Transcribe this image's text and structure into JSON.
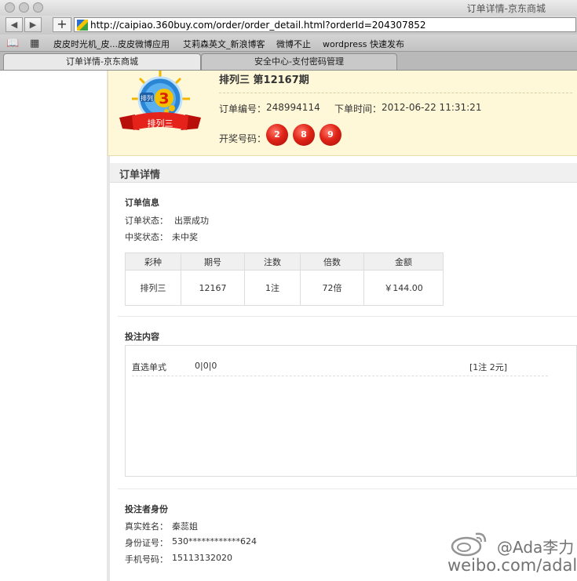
{
  "window": {
    "title": "订单详情-京东商城"
  },
  "toolbar": {
    "url": "http://caipiao.360buy.com/order/order_detail.html?orderId=204307852"
  },
  "bookmarks": [
    {
      "label": "皮皮时光机_皮...皮皮微博应用"
    },
    {
      "label": "艾莉森英文_新浪博客"
    },
    {
      "label": "微博不止"
    },
    {
      "label": "wordpress 快速发布"
    }
  ],
  "tabs": [
    {
      "label": "订单详情-京东商城"
    },
    {
      "label": "安全中心-支付密码管理"
    }
  ],
  "banner": {
    "logo_badge": "排列",
    "logo_number": "3",
    "logo_ribbon": "排列三",
    "lottery_title": "排列三 第12167期",
    "order_no_label": "订单编号：",
    "order_no": "248994114",
    "order_time_label": "下单时间：",
    "order_time": "2012-06-22 11:31:21",
    "draw_label": "开奖号码：",
    "draw_numbers": [
      "2",
      "8",
      "9"
    ]
  },
  "detail": {
    "heading": "订单详情",
    "info_title": "订单信息",
    "status_label": "订单状态：",
    "status_value": "出票成功",
    "win_label": "中奖状态：",
    "win_value": "未中奖",
    "table": {
      "headers": [
        "彩种",
        "期号",
        "注数",
        "倍数",
        "金额"
      ],
      "rows": [
        [
          "排列三",
          "12167",
          "1注",
          "72倍",
          "￥144.00"
        ]
      ]
    },
    "bet_title": "投注内容",
    "bet_type": "直选单式",
    "bet_numbers": "0|0|0",
    "bet_summary": "[1注 2元]",
    "bettor_title": "投注者身份",
    "name_label": "真实姓名：",
    "name_value": "秦蕊姐",
    "id_label": "身份证号：",
    "id_value": "530************624",
    "phone_label": "手机号码：",
    "phone_value": "15113132020"
  },
  "watermark": {
    "line1": "@Ada李力",
    "line2": "weibo.com/adali"
  }
}
